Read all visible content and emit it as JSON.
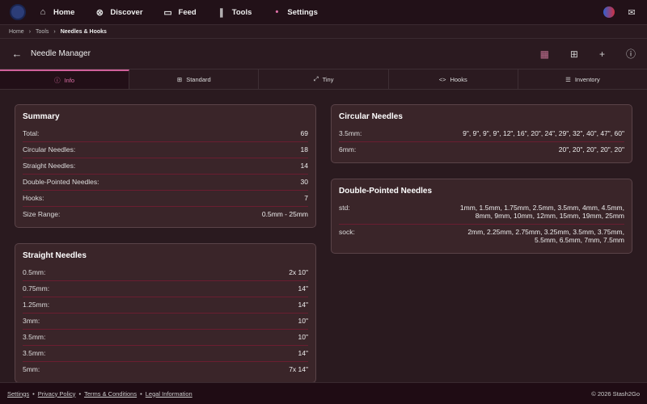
{
  "nav": {
    "items": [
      {
        "label": "Home",
        "icon": "home-icon"
      },
      {
        "label": "Discover",
        "icon": "compass-icon"
      },
      {
        "label": "Feed",
        "icon": "feed-icon"
      },
      {
        "label": "Tools",
        "icon": "needles-icon"
      },
      {
        "label": "Settings",
        "icon": "settings-icon"
      }
    ]
  },
  "breadcrumb": [
    "Home",
    "Tools",
    "Needles & Hooks"
  ],
  "header": {
    "title": "Needle Manager"
  },
  "tabs": [
    "Info",
    "Standard",
    "Tiny",
    "Hooks",
    "Inventory"
  ],
  "summary": {
    "title": "Summary",
    "rows": [
      [
        "Total:",
        "69"
      ],
      [
        "Circular Needles:",
        "18"
      ],
      [
        "Straight Needles:",
        "14"
      ],
      [
        "Double-Pointed Needles:",
        "30"
      ],
      [
        "Hooks:",
        "7"
      ],
      [
        "Size Range:",
        "0.5mm - 25mm"
      ]
    ]
  },
  "straight": {
    "title": "Straight Needles",
    "rows": [
      [
        "0.5mm:",
        "2x 10\""
      ],
      [
        "0.75mm:",
        "14\""
      ],
      [
        "1.25mm:",
        "14\""
      ],
      [
        "3mm:",
        "10\""
      ],
      [
        "3.5mm:",
        "10\""
      ],
      [
        "3.5mm:",
        "14\""
      ],
      [
        "5mm:",
        "7x 14\""
      ]
    ]
  },
  "circular": {
    "title": "Circular Needles",
    "rows": [
      [
        "3.5mm:",
        "9\", 9\", 9\", 9\", 12\", 16\", 20\", 24\", 29\", 32\", 40\", 47\", 60\""
      ],
      [
        "6mm:",
        "20\", 20\", 20\", 20\", 20\""
      ]
    ]
  },
  "dpn": {
    "title": "Double-Pointed Needles",
    "rows": [
      [
        "std:",
        "1mm, 1.5mm, 1.75mm, 2.5mm, 3.5mm, 4mm, 4.5mm,",
        "8mm, 9mm, 10mm, 12mm, 15mm, 19mm, 25mm"
      ],
      [
        "sock:",
        "2mm, 2.25mm, 2.75mm, 3.25mm, 3.5mm, 3.75mm,",
        "5.5mm, 6.5mm, 7mm, 7.5mm"
      ]
    ]
  },
  "footer": {
    "links": [
      "Settings",
      "Privacy Policy",
      "Terms & Conditions",
      "Legal Information"
    ],
    "copyright": "© 2026 Stash2Go"
  }
}
